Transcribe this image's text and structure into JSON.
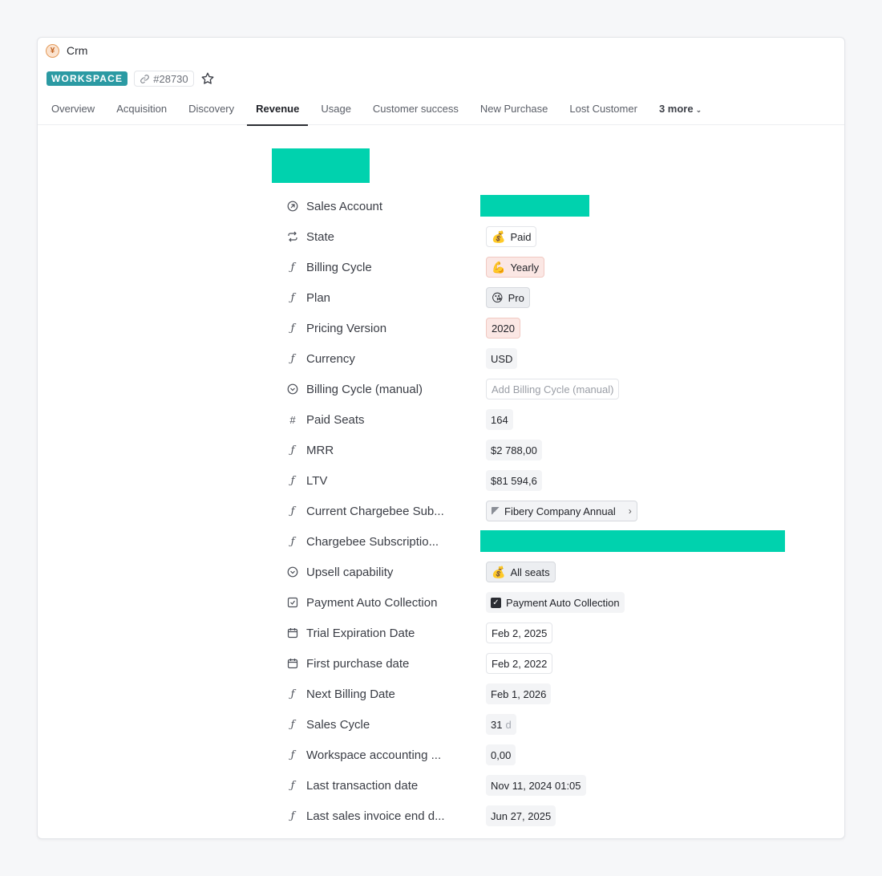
{
  "app": {
    "name": "Crm",
    "icon": "yen-icon"
  },
  "entity": {
    "type_badge": "WORKSPACE",
    "id": "#28730"
  },
  "tabs": [
    {
      "label": "Overview"
    },
    {
      "label": "Acquisition"
    },
    {
      "label": "Discovery"
    },
    {
      "label": "Revenue",
      "active": true
    },
    {
      "label": "Usage"
    },
    {
      "label": "Customer success"
    },
    {
      "label": "New Purchase"
    },
    {
      "label": "Lost Customer"
    }
  ],
  "more_tabs": "3 more",
  "colors": {
    "accent": "#2b9aa3",
    "redaction": "#00d2ae"
  },
  "fields": {
    "sales_account": {
      "label": "Sales Account",
      "icon": "arrow-up-right-circle-icon"
    },
    "state": {
      "label": "State",
      "icon": "repeat-icon",
      "value": "Paid",
      "emoji": "💰"
    },
    "billing_cycle": {
      "label": "Billing Cycle",
      "icon": "formula-icon",
      "value": "Yearly",
      "emoji": "💪"
    },
    "plan": {
      "label": "Plan",
      "icon": "formula-icon",
      "value": "Pro",
      "emoji": "😘"
    },
    "pricing_version": {
      "label": "Pricing Version",
      "icon": "formula-icon",
      "value": "2020"
    },
    "currency": {
      "label": "Currency",
      "icon": "formula-icon",
      "value": "USD"
    },
    "billing_cycle_manual": {
      "label": "Billing Cycle (manual)",
      "icon": "chevron-down-circle-icon",
      "placeholder": "Add Billing Cycle (manual)"
    },
    "paid_seats": {
      "label": "Paid Seats",
      "icon": "hash-icon",
      "value": "164"
    },
    "mrr": {
      "label": "MRR",
      "icon": "formula-icon",
      "value": "$2 788,00"
    },
    "ltv": {
      "label": "LTV",
      "icon": "formula-icon",
      "value": "$81 594,6"
    },
    "current_chargebee_sub": {
      "label": "Current Chargebee Sub...",
      "icon": "formula-icon",
      "value": "Fibery Company Annual"
    },
    "chargebee_subscription": {
      "label": "Chargebee Subscriptio...",
      "icon": "formula-icon"
    },
    "upsell_capability": {
      "label": "Upsell capability",
      "icon": "chevron-down-circle-icon",
      "value": "All seats",
      "emoji": "💰"
    },
    "payment_auto_collection": {
      "label": "Payment Auto Collection",
      "icon": "checkbox-icon",
      "value": "Payment Auto Collection",
      "checked": true
    },
    "trial_expiration_date": {
      "label": "Trial Expiration Date",
      "icon": "calendar-icon",
      "value": "Feb 2, 2025"
    },
    "first_purchase_date": {
      "label": "First purchase date",
      "icon": "calendar-icon",
      "value": "Feb 2, 2022"
    },
    "next_billing_date": {
      "label": "Next Billing Date",
      "icon": "formula-icon",
      "value": "Feb 1, 2026"
    },
    "sales_cycle": {
      "label": "Sales Cycle",
      "icon": "formula-icon",
      "value": "31",
      "unit": "d"
    },
    "workspace_accounting": {
      "label": "Workspace accounting ...",
      "icon": "formula-icon",
      "value": "0,00"
    },
    "last_transaction_date": {
      "label": "Last transaction date",
      "icon": "formula-icon",
      "value": "Nov 11, 2024 01:05"
    },
    "last_sales_invoice_end": {
      "label": "Last sales invoice end d...",
      "icon": "formula-icon",
      "value": "Jun 27, 2025"
    }
  }
}
